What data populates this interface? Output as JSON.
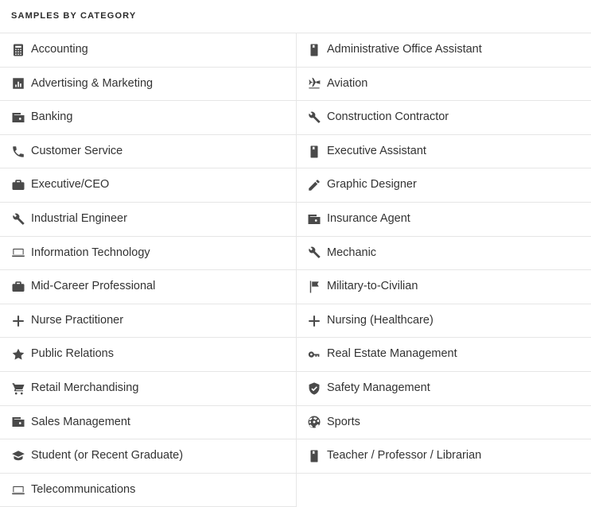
{
  "header": {
    "title": "Samples by Category"
  },
  "colors": {
    "icon": "#4a4a4a",
    "label": "#333333",
    "divider": "#e6e6e6",
    "background": "#ffffff"
  },
  "categories": {
    "left": [
      {
        "label": "Accounting",
        "icon": "calculator-icon"
      },
      {
        "label": "Advertising & Marketing",
        "icon": "bar-chart-icon"
      },
      {
        "label": "Banking",
        "icon": "wallet-icon"
      },
      {
        "label": "Customer Service",
        "icon": "phone-icon"
      },
      {
        "label": "Executive/CEO",
        "icon": "briefcase-icon"
      },
      {
        "label": "Industrial Engineer",
        "icon": "wrench-icon"
      },
      {
        "label": "Information Technology",
        "icon": "laptop-icon"
      },
      {
        "label": "Mid-Career Professional",
        "icon": "briefcase-icon"
      },
      {
        "label": "Nurse Practitioner",
        "icon": "plus-icon"
      },
      {
        "label": "Public Relations",
        "icon": "star-icon"
      },
      {
        "label": "Retail Merchandising",
        "icon": "shopping-cart-icon"
      },
      {
        "label": "Sales Management",
        "icon": "wallet-icon"
      },
      {
        "label": "Student (or Recent Graduate)",
        "icon": "graduation-cap-icon"
      },
      {
        "label": "Telecommunications",
        "icon": "laptop-icon"
      }
    ],
    "right": [
      {
        "label": "Administrative Office Assistant",
        "icon": "book-icon"
      },
      {
        "label": "Aviation",
        "icon": "airplane-icon"
      },
      {
        "label": "Construction Contractor",
        "icon": "wrench-icon"
      },
      {
        "label": "Executive Assistant",
        "icon": "book-icon"
      },
      {
        "label": "Graphic Designer",
        "icon": "pencil-icon"
      },
      {
        "label": "Insurance Agent",
        "icon": "wallet-icon"
      },
      {
        "label": "Mechanic",
        "icon": "wrench-icon"
      },
      {
        "label": "Military-to-Civilian",
        "icon": "flag-icon"
      },
      {
        "label": "Nursing (Healthcare)",
        "icon": "plus-icon"
      },
      {
        "label": "Real Estate Management",
        "icon": "key-icon"
      },
      {
        "label": "Safety Management",
        "icon": "shield-check-icon"
      },
      {
        "label": "Sports",
        "icon": "basketball-icon"
      },
      {
        "label": "Teacher / Professor / Librarian",
        "icon": "book-icon"
      }
    ]
  }
}
